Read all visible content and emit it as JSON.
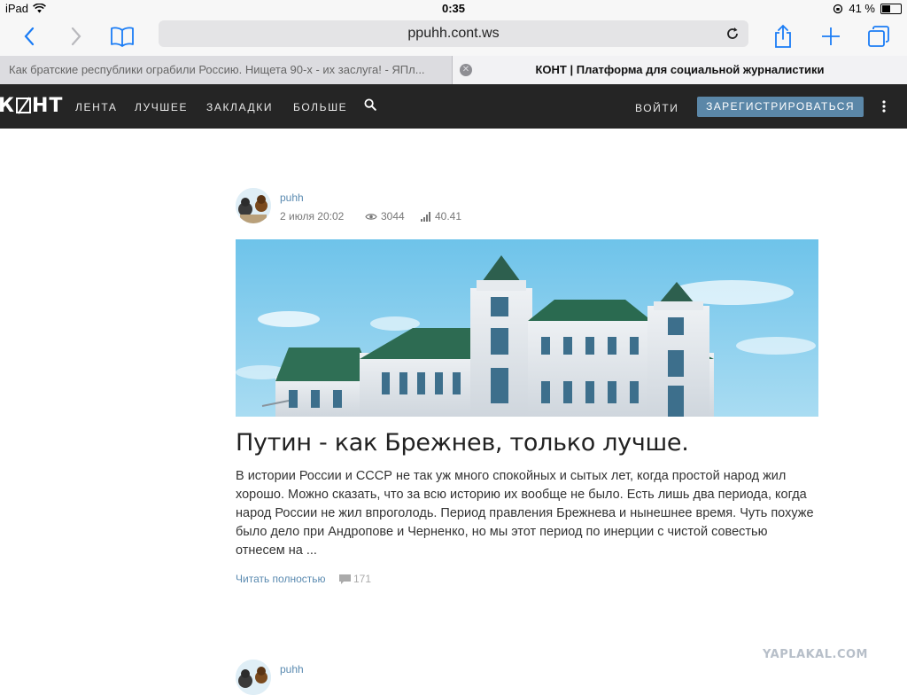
{
  "status_bar": {
    "device": "iPad",
    "time": "0:35",
    "battery_text": "41 %",
    "battery_level": 0.41
  },
  "browser": {
    "url": "ppuhh.cont.ws"
  },
  "tabs": [
    {
      "title": "Как братские республики ограбили Россию. Нищета 90-х - их заслуга! - ЯПл..."
    },
    {
      "title": "КОНТ | Платформа для социальной журналистики"
    }
  ],
  "site": {
    "logo_left": "К",
    "logo_right": "НТ",
    "nav": [
      "ЛЕНТА",
      "ЛУЧШЕЕ",
      "ЗАКЛАДКИ",
      "БОЛЬШЕ"
    ],
    "login": "ВОЙТИ",
    "register": "ЗАРЕГИСТРИРОВАТЬСЯ"
  },
  "post": {
    "author": "puhh",
    "date": "2 июля 20:02",
    "views": "3044",
    "rating": "40.41",
    "title": "Путин - как Брежнев, только лучше.",
    "excerpt": " В истории России и СССР не так уж много спокойных и сытых лет, когда простой народ жил хорошо. Можно сказать, что за всю историю их вообще не было. Есть лишь два периода, когда народ России не жил впроголодь. Период правления Брежнева и нынешнее время. Чуть похуже было дело при Андропове и Черненко, но мы этот период по инерции с чистой совестью отнесем на ...",
    "read_more": "Читать полностью",
    "comments": "171"
  },
  "next_post": {
    "author": "puhh"
  },
  "watermark": "YAPLAKAL.COM",
  "colors": {
    "accent": "#1a7cf5",
    "nav_bg": "#252525",
    "register_bg": "#5b87a8",
    "link": "#5a8ab0"
  }
}
